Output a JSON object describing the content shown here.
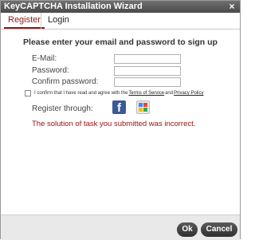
{
  "window": {
    "title": "KeyCAPTCHA Installation Wizard",
    "close_glyph": "×"
  },
  "tabs": [
    {
      "label": "Register",
      "active": true
    },
    {
      "label": "Login",
      "active": false
    }
  ],
  "form": {
    "heading": "Please enter your email and password to sign up",
    "email_label": "E-Mail:",
    "email_value": "",
    "password_label": "Password:",
    "password_value": "",
    "confirm_label": "Confirm password:",
    "confirm_value": "",
    "agree_checked": false,
    "agree_text_prefix": "I confirm that I have read and agree with the",
    "terms_link": "Terms of Service",
    "agree_and": "and",
    "privacy_link": "Privacy Policy",
    "register_through_label": "Register through:",
    "social": [
      {
        "name": "facebook",
        "icon": "facebook-icon",
        "glyph": "f",
        "color": "#3b5998"
      },
      {
        "name": "google-plus",
        "icon": "google-plus-icon",
        "colors": [
          "#4285f4",
          "#ea4335",
          "#fbbc05",
          "#34a853"
        ]
      }
    ],
    "error_message": "The solution of task you submitted was incorrect."
  },
  "footer": {
    "ok_label": "Ok",
    "cancel_label": "Cancel"
  },
  "colors": {
    "title_bar": "#4a4a4a",
    "accent_tab": "#8b1a1a",
    "error": "#a01010",
    "footer_bg": "#e9e9e9",
    "button_bg": "#3a3a3a"
  }
}
